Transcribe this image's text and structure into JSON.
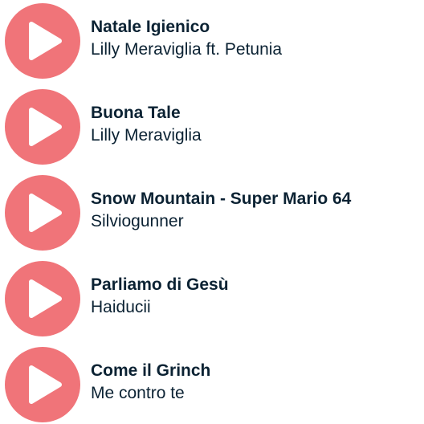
{
  "accent_color": "#f07479",
  "icon": "play-icon",
  "tracks": [
    {
      "title": "Natale Igienico",
      "artist": "Lilly Meraviglia ft. Petunia"
    },
    {
      "title": "Buona Tale",
      "artist": "Lilly Meraviglia"
    },
    {
      "title": "Snow Mountain - Super Mario 64",
      "artist": "Silviogunner"
    },
    {
      "title": "Parliamo di Gesù",
      "artist": "Haiducii"
    },
    {
      "title": "Come il Grinch",
      "artist": "Me contro te"
    }
  ]
}
